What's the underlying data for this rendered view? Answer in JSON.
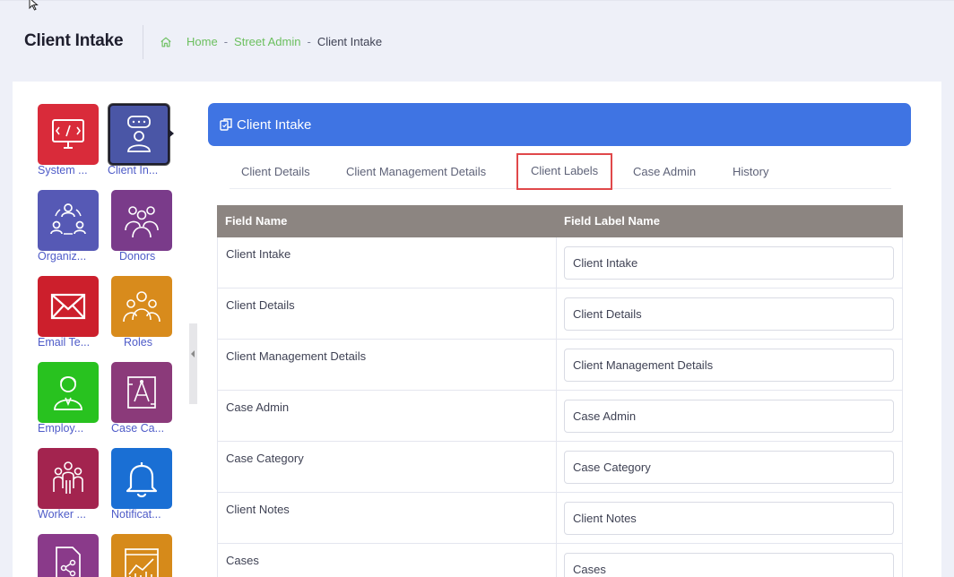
{
  "header": {
    "title": "Client Intake",
    "breadcrumb": [
      "Home",
      "Street Admin",
      "Client Intake"
    ],
    "separator": "-"
  },
  "sidebar": {
    "tiles": [
      {
        "label": "System ...",
        "icon": "monitor-code-icon",
        "color": "#d92b3a",
        "active": false
      },
      {
        "label": "Client In...",
        "icon": "user-chat-icon",
        "color": "#4a56a6",
        "active": true
      },
      {
        "label": "Organiz...",
        "icon": "organization-cycle-icon",
        "color": "#5659b5",
        "active": false
      },
      {
        "label": "Donors",
        "icon": "group-people-icon",
        "color": "#7a3b8a",
        "active": false
      },
      {
        "label": "Email Te...",
        "icon": "envelope-icon",
        "color": "#cc1f2c",
        "active": false
      },
      {
        "label": "Roles",
        "icon": "team-roles-icon",
        "color": "#d88b1c",
        "active": false
      },
      {
        "label": "Employ...",
        "icon": "employee-icon",
        "color": "#28c21f",
        "active": false
      },
      {
        "label": "Case Ca...",
        "icon": "case-category-icon",
        "color": "#8b3a7a",
        "active": false
      },
      {
        "label": "Worker ...",
        "icon": "workers-icon",
        "color": "#a3244f",
        "active": false
      },
      {
        "label": "Notificat...",
        "icon": "bell-icon",
        "color": "#1a6fd4",
        "active": false
      },
      {
        "label": "",
        "icon": "document-share-icon",
        "color": "#8a3a8a",
        "active": false
      },
      {
        "label": "",
        "icon": "analytics-report-icon",
        "color": "#d68a1a",
        "active": false
      }
    ]
  },
  "panel": {
    "title": "Client Intake",
    "tabs": [
      "Client Details",
      "Client Management Details",
      "Client Labels",
      "Case Admin",
      "History"
    ],
    "selected_tab": "Client Labels"
  },
  "table": {
    "columns": [
      "Field Name",
      "Field Label Name"
    ],
    "rows": [
      {
        "field": "Client Intake",
        "label": "Client Intake"
      },
      {
        "field": "Client Details",
        "label": "Client Details"
      },
      {
        "field": "Client Management Details",
        "label": "Client Management Details"
      },
      {
        "field": "Case Admin",
        "label": "Case Admin"
      },
      {
        "field": "Case Category",
        "label": "Case Category"
      },
      {
        "field": "Client Notes",
        "label": "Client Notes"
      },
      {
        "field": "Cases",
        "label": "Cases"
      }
    ]
  },
  "colors": {
    "accent_blue": "#3f74e3",
    "breadcrumb_green": "#6bbf5e",
    "tab_highlight": "#e0484a",
    "table_header": "#8c8581",
    "tile_label": "#4e5bc8"
  }
}
